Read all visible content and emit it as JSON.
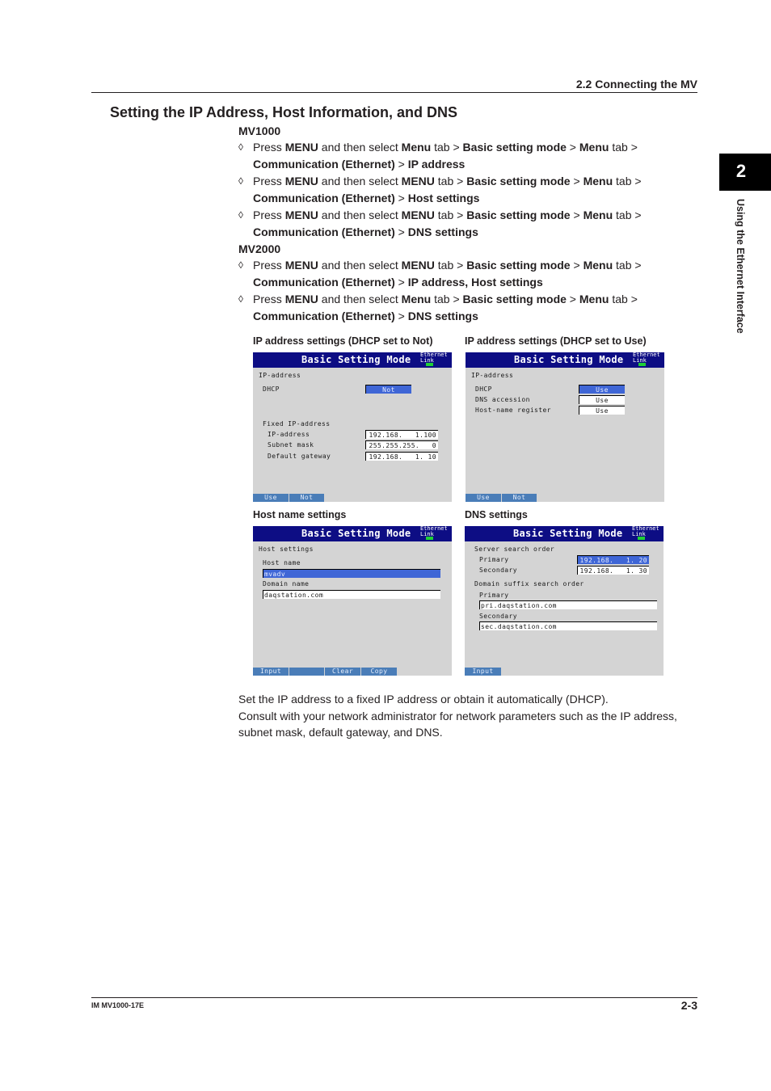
{
  "header": {
    "section": "2.2  Connecting the MV"
  },
  "title": "Setting the IP Address, Host Information, and DNS",
  "chapter": {
    "number": "2",
    "label": "Using the Ethernet Interface"
  },
  "mv1000": {
    "label": "MV1000",
    "steps": [
      {
        "line1": [
          [
            "",
            "Press "
          ],
          [
            "b",
            "MENU"
          ],
          [
            "",
            " and then select "
          ],
          [
            "b",
            "Menu"
          ],
          [
            "",
            " tab > "
          ],
          [
            "b",
            "Basic setting mode"
          ],
          [
            "",
            " > "
          ],
          [
            "b",
            "Menu"
          ],
          [
            "",
            " tab >"
          ]
        ],
        "line2": [
          [
            "b",
            "Communication (Ethernet)"
          ],
          [
            "",
            " > "
          ],
          [
            "b",
            "IP address"
          ]
        ]
      },
      {
        "line1": [
          [
            "",
            "Press "
          ],
          [
            "b",
            "MENU"
          ],
          [
            "",
            " and then select "
          ],
          [
            "b",
            "MENU"
          ],
          [
            "",
            " tab > "
          ],
          [
            "b",
            "Basic setting mode"
          ],
          [
            "",
            " > "
          ],
          [
            "b",
            "Menu"
          ],
          [
            "",
            " tab >"
          ]
        ],
        "line2": [
          [
            "b",
            "Communication (Ethernet)"
          ],
          [
            "",
            " > "
          ],
          [
            "b",
            "Host settings"
          ]
        ]
      },
      {
        "line1": [
          [
            "",
            "Press "
          ],
          [
            "b",
            "MENU"
          ],
          [
            "",
            " and then select "
          ],
          [
            "b",
            "MENU"
          ],
          [
            "",
            " tab > "
          ],
          [
            "b",
            "Basic setting mode"
          ],
          [
            "",
            " > "
          ],
          [
            "b",
            "Menu"
          ],
          [
            "",
            " tab >"
          ]
        ],
        "line2": [
          [
            "b",
            "Communication (Ethernet)"
          ],
          [
            "",
            " > "
          ],
          [
            "b",
            "DNS settings"
          ]
        ]
      }
    ]
  },
  "mv2000": {
    "label": "MV2000",
    "steps": [
      {
        "line1": [
          [
            "",
            "Press "
          ],
          [
            "b",
            "MENU"
          ],
          [
            "",
            " and then select "
          ],
          [
            "b",
            "MENU"
          ],
          [
            "",
            " tab > "
          ],
          [
            "b",
            "Basic setting mode"
          ],
          [
            "",
            " > "
          ],
          [
            "b",
            "Menu"
          ],
          [
            "",
            " tab >"
          ]
        ],
        "line2": [
          [
            "b",
            "Communication (Ethernet)"
          ],
          [
            "",
            " > "
          ],
          [
            "b",
            "IP address, Host settings"
          ]
        ]
      },
      {
        "line1": [
          [
            "",
            "Press "
          ],
          [
            "b",
            "MENU"
          ],
          [
            "",
            " and then select "
          ],
          [
            "b",
            "Menu"
          ],
          [
            "",
            " tab > "
          ],
          [
            "b",
            "Basic setting mode"
          ],
          [
            "",
            " > "
          ],
          [
            "b",
            "Menu"
          ],
          [
            "",
            " tab >"
          ]
        ],
        "line2": [
          [
            "b",
            "Communication (Ethernet)"
          ],
          [
            "",
            " > "
          ],
          [
            "b",
            "DNS settings"
          ]
        ]
      }
    ]
  },
  "bullet": "◊",
  "screens": {
    "common": {
      "title": "Basic Setting Mode",
      "eth_line1": "Ethernet",
      "eth_line2": "Link",
      "title_bg": "#0d0d84",
      "link_led": "#1fcf36",
      "softkey_bg": "#4a7db8",
      "selected_bg": "#3f66d6"
    },
    "ip_not": {
      "caption": "IP address settings (DHCP set to Not)",
      "heading": "IP-address",
      "dhcp_label": "DHCP",
      "dhcp_value": "Not",
      "fixed_heading": "Fixed IP-address",
      "ip_label": "IP-address",
      "ip_value": "192.168.   1.100",
      "mask_label": "Subnet mask",
      "mask_value": "255.255.255.   0",
      "gw_label": "Default gateway",
      "gw_value": "192.168.   1. 10",
      "softkeys": [
        "Use",
        "Not"
      ]
    },
    "ip_use": {
      "caption": "IP address settings (DHCP set to Use)",
      "heading": "IP-address",
      "dhcp_label": "DHCP",
      "dhcp_value": "Use",
      "dns_label": "DNS accession",
      "dns_value": "Use",
      "host_label": "Host-name register",
      "host_value": "Use",
      "softkeys": [
        "Use",
        "Not"
      ]
    },
    "host": {
      "caption": "Host name settings",
      "heading": "Host settings",
      "host_label": "Host name",
      "host_value": "mvadv",
      "domain_label": "Domain name",
      "domain_value": "daqstation.com",
      "softkeys": [
        "Input",
        "",
        "Clear",
        "Copy"
      ]
    },
    "dns": {
      "caption": "DNS settings",
      "server_heading": "Server search order",
      "primary_label": "Primary",
      "primary_value": "192.168.   1. 20",
      "secondary_label": "Secondary",
      "secondary_value": "192.168.   1. 30",
      "suffix_heading": "Domain suffix search order",
      "sfx_primary_label": "Primary",
      "sfx_primary_value": "pri.daqstation.com",
      "sfx_secondary_label": "Secondary",
      "sfx_secondary_value": "sec.daqstation.com",
      "softkeys": [
        "Input"
      ]
    }
  },
  "body": {
    "line1": "Set the IP address to a fixed IP address or obtain it automatically (DHCP).",
    "line2": "Consult with your network administrator for network parameters such as the IP address, subnet mask, default gateway, and DNS."
  },
  "footer": {
    "doc_id": "IM MV1000-17E",
    "page": "2-3"
  }
}
